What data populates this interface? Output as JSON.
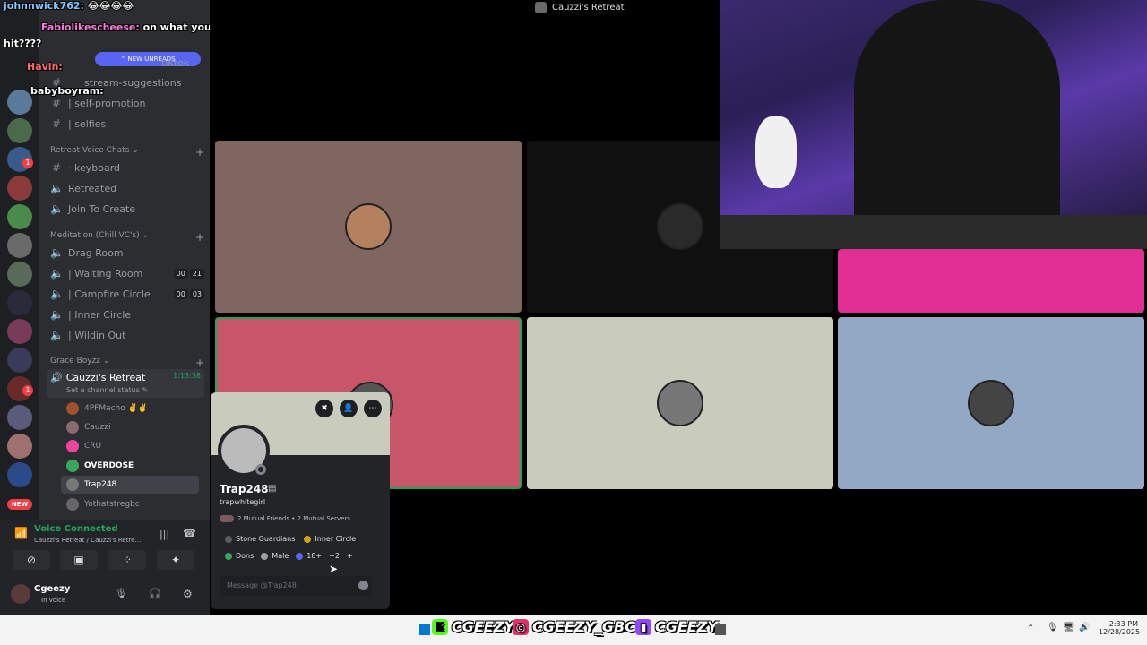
{
  "window_title": "Cauzzi's Retreat",
  "chat_overlay": [
    {
      "user": "johnnwick762:",
      "message": "😂😂😂😂",
      "color": "#7ec8ff"
    },
    {
      "user": "Fabiolikescheese:",
      "message": "on what you sent that",
      "color": "#ff7be0"
    },
    {
      "user": "",
      "message": "hit????",
      "color": "#ffffff"
    },
    {
      "user": "Havin:",
      "message": "",
      "color": "#ff6b6b"
    },
    {
      "user": "babyboyram:",
      "message": "",
      "color": "#ffffff"
    }
  ],
  "new_unreads": "NEW UNREADS",
  "channels_top": [
    {
      "glyph": "#",
      "label": "tiktok"
    },
    {
      "glyph": "#",
      "label": "stream-suggestions"
    },
    {
      "glyph": "#",
      "label": "| self-promotion"
    },
    {
      "glyph": "#",
      "label": "| selfies"
    }
  ],
  "category_voice": "Retreat Voice Chats",
  "voice_channels": [
    {
      "glyph": "#",
      "label": "· keyboard"
    },
    {
      "glyph": "🔈",
      "label": "Retreated"
    },
    {
      "glyph": "🔈",
      "label": "Join To Create"
    }
  ],
  "category_meditation": "Meditation (Chill VC's)",
  "meditation_channels": [
    {
      "glyph": "🔈",
      "label": "Drag Room",
      "counter": []
    },
    {
      "glyph": "🔈",
      "label": "| Waiting Room",
      "counter": [
        "00",
        "21"
      ]
    },
    {
      "glyph": "🔈",
      "label": "| Campfire Circle",
      "counter": [
        "00",
        "03"
      ]
    },
    {
      "glyph": "🔈",
      "label": "| Inner Circle",
      "counter": []
    },
    {
      "glyph": "🔈",
      "label": "| Wildin Out",
      "counter": []
    }
  ],
  "category_grace": "Grace Boyzz",
  "active_channel": {
    "label": "Cauzzi's Retreat",
    "timer": "1:13:38",
    "status": "Set a channel status"
  },
  "members": [
    {
      "name": "4PFMacho ✌️✌️",
      "color": "#a0522d"
    },
    {
      "name": "Cauzzi",
      "color": "#8b6b6b"
    },
    {
      "name": "CRU",
      "color": "#eb459e"
    },
    {
      "name": "OVERDOSE",
      "color": "#3ba55d"
    },
    {
      "name": "Trap248",
      "color": "#777777"
    },
    {
      "name": "Yothatstregbc",
      "color": "#666666"
    }
  ],
  "voice_status": {
    "title": "Voice Connected",
    "sub": "Cauzzi's Retreat / Cauzzi's Retre..."
  },
  "user": {
    "name": "Cgeezy",
    "status": "In voice"
  },
  "profile": {
    "display_name": "Trap248",
    "username": "trapwhitegirl",
    "mutuals": "2 Mutual Friends • 2 Mutual Servers",
    "roles": [
      {
        "label": "Stone Guardians",
        "color": "#5c5c5c"
      },
      {
        "label": "Inner Circle",
        "color": "#d4a017"
      },
      {
        "label": "Dons",
        "color": "#3ba55d"
      },
      {
        "label": "Male",
        "color": "#9e9e9e"
      },
      {
        "label": "18+",
        "color": "#5865f2"
      }
    ],
    "more_roles": "+2",
    "message_placeholder": "Message @Trap248"
  },
  "socials": [
    {
      "label": "CGEEZY",
      "icon": "kick-icon",
      "color": "#53fc18",
      "glyph": "K"
    },
    {
      "label": "CGEEZY_GBC",
      "icon": "instagram-icon",
      "color": "#e1306c",
      "glyph": "◎"
    },
    {
      "label": "CGEEZY",
      "icon": "twitch-icon",
      "color": "#9146ff",
      "glyph": "▮"
    }
  ],
  "clock": {
    "time": "2:33 PM",
    "date": "12/28/2025"
  },
  "tile_colors": [
    "#7f6661",
    "#101010",
    "#e02e95",
    "#c7566b",
    "#c9cbbc",
    "#93a8c4"
  ]
}
